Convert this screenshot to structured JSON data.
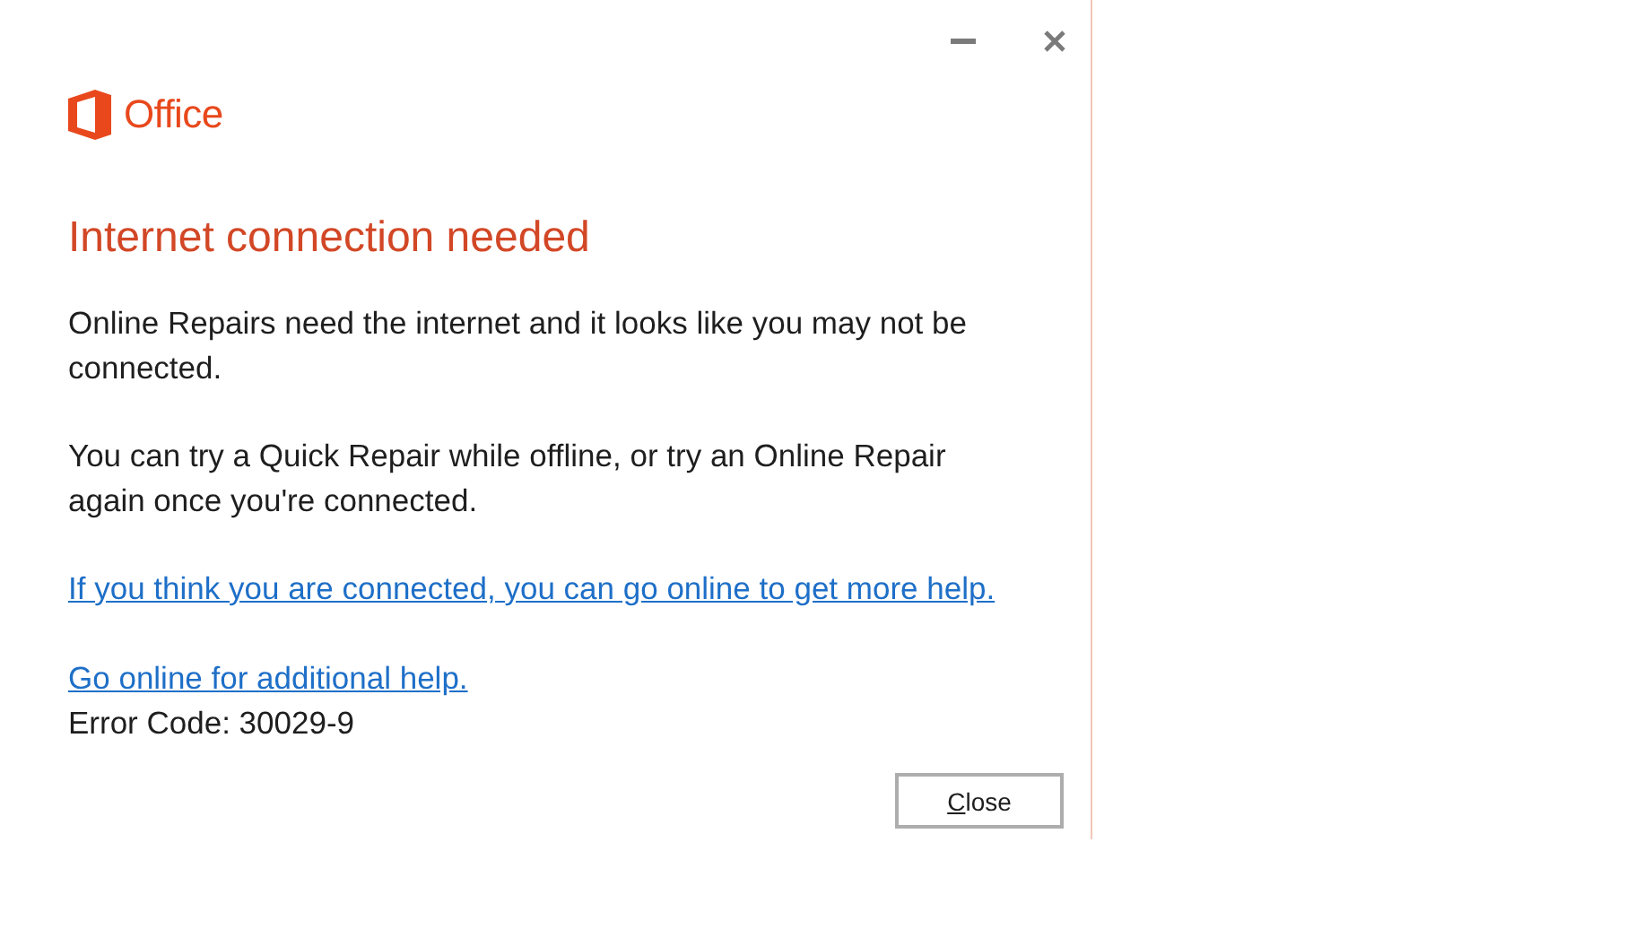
{
  "window": {
    "logo": "Office"
  },
  "title": "Internet connection needed",
  "paragraphs": [
    "Online Repairs need the internet and it looks like you may not be connected.",
    "You can try a Quick Repair while offline, or try an Online Repair again once you're connected."
  ],
  "links": [
    "If you think you are connected, you can go online to get more help.",
    "Go online for additional help."
  ],
  "error_code": "Error Code: 30029-9",
  "buttons": [
    {
      "access_key": "C",
      "label_rest": "lose"
    }
  ]
}
